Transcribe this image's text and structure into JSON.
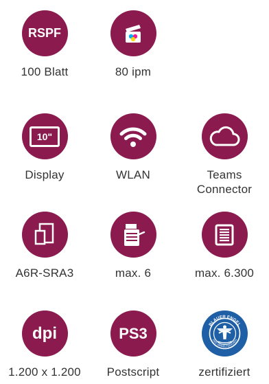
{
  "colors": {
    "accent": "#8b1a4e",
    "label": "#333333",
    "engel_blue": "#1f5fa6"
  },
  "features": [
    {
      "icon": "rspf-icon",
      "icon_text": "RSPF",
      "label": "100 Blatt"
    },
    {
      "icon": "scanner-speed-icon",
      "label": "80 ipm"
    },
    {
      "icon": "display-10-icon",
      "icon_text": "10\"",
      "label": "Display"
    },
    {
      "icon": "wifi-icon",
      "label": "WLAN"
    },
    {
      "icon": "cloud-icon",
      "label": "Teams\nConnector"
    },
    {
      "icon": "paper-sizes-icon",
      "label": "A6R-SRA3"
    },
    {
      "icon": "paper-trays-icon",
      "label": "max. 6"
    },
    {
      "icon": "paper-stack-icon",
      "label": "max. 6.300"
    },
    {
      "icon": "dpi-icon",
      "icon_text": "dpi",
      "label": "1.200 x 1.200"
    },
    {
      "icon": "ps3-icon",
      "icon_text": "PS3",
      "label": "Postscript"
    },
    {
      "icon": "blauer-engel-icon",
      "icon_text": "BLAUER ENGEL",
      "icon_subtext": "DAS UMWELTZEICHEN",
      "label": "zertifiziert"
    }
  ]
}
